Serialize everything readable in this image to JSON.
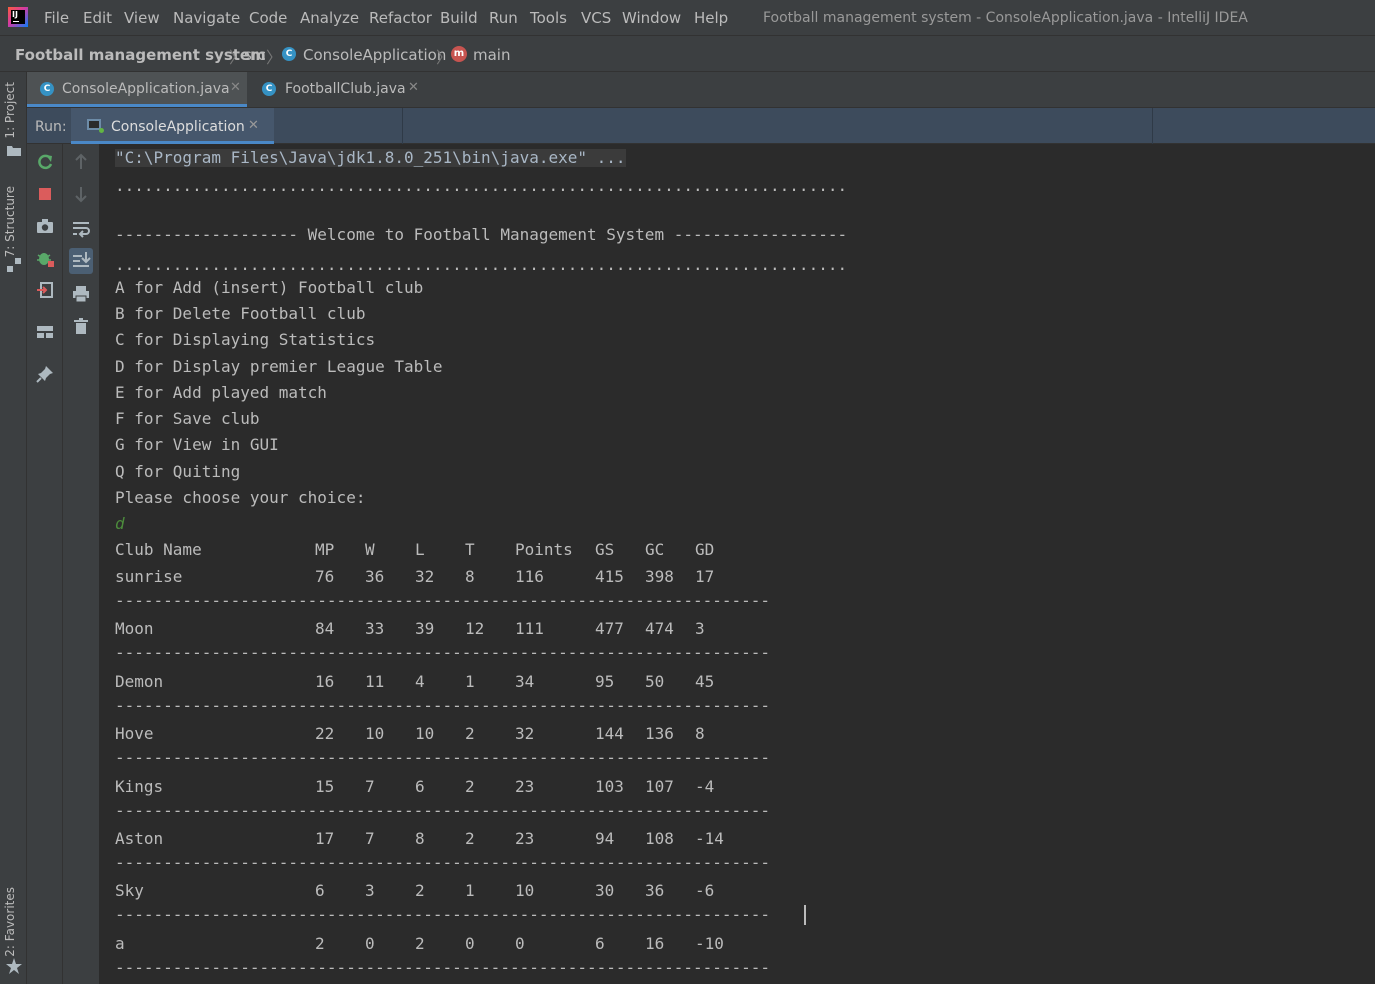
{
  "menubar": {
    "items": [
      "File",
      "Edit",
      "View",
      "Navigate",
      "Code",
      "Analyze",
      "Refactor",
      "Build",
      "Run",
      "Tools",
      "VCS",
      "Window",
      "Help"
    ],
    "window_title": "Football management system - ConsoleApplication.java - IntelliJ IDEA"
  },
  "breadcrumb": {
    "project": "Football management system",
    "folder": "src",
    "class": "ConsoleApplication",
    "method": "main"
  },
  "left_strip": {
    "project_tab": "1: Project",
    "structure_tab": "7: Structure",
    "favorites_tab": "2: Favorites"
  },
  "editor_tabs": [
    {
      "label": "ConsoleApplication.java",
      "active": true
    },
    {
      "label": "FootballClub.java",
      "active": false
    }
  ],
  "run_panel": {
    "label": "Run:",
    "tab_label": "ConsoleApplication"
  },
  "console": {
    "command": "\"C:\\Program Files\\Java\\jdk1.8.0_251\\bin\\java.exe\" ...",
    "dots": "............................................................................",
    "welcome": "------------------- Welcome to Football Management System ------------------",
    "menu": [
      "A for Add (insert) Football club",
      "B for Delete Football club",
      "C for Displaying Statistics",
      "D for Display premier League Table",
      "E for Add played match",
      "F for Save club",
      "G for View in GUI",
      "Q for Quiting",
      "Please choose your choice:"
    ],
    "user_input": "d",
    "table_headers": [
      "Club Name",
      "MP",
      "W",
      "L",
      "T",
      "Points",
      "GS",
      "GC",
      "GD"
    ],
    "rows": [
      [
        "sunrise",
        "76",
        "36",
        "32",
        "8",
        "116",
        "415",
        "398",
        "17"
      ],
      [
        "Moon",
        "84",
        "33",
        "39",
        "12",
        "111",
        "477",
        "474",
        "3"
      ],
      [
        "Demon",
        "16",
        "11",
        "4",
        "1",
        "34",
        "95",
        "50",
        "45"
      ],
      [
        "Hove",
        "22",
        "10",
        "10",
        "2",
        "32",
        "144",
        "136",
        "8"
      ],
      [
        "Kings",
        "15",
        "7",
        "6",
        "2",
        "23",
        "103",
        "107",
        "-4"
      ],
      [
        "Aston",
        "17",
        "7",
        "8",
        "2",
        "23",
        "94",
        "108",
        "-14"
      ],
      [
        "Sky",
        "6",
        "3",
        "2",
        "1",
        "10",
        "30",
        "36",
        "-6"
      ],
      [
        "a",
        "2",
        "0",
        "2",
        "0",
        "0",
        "6",
        "16",
        "-10"
      ]
    ],
    "separator": "--------------------------------------------------------------------"
  }
}
